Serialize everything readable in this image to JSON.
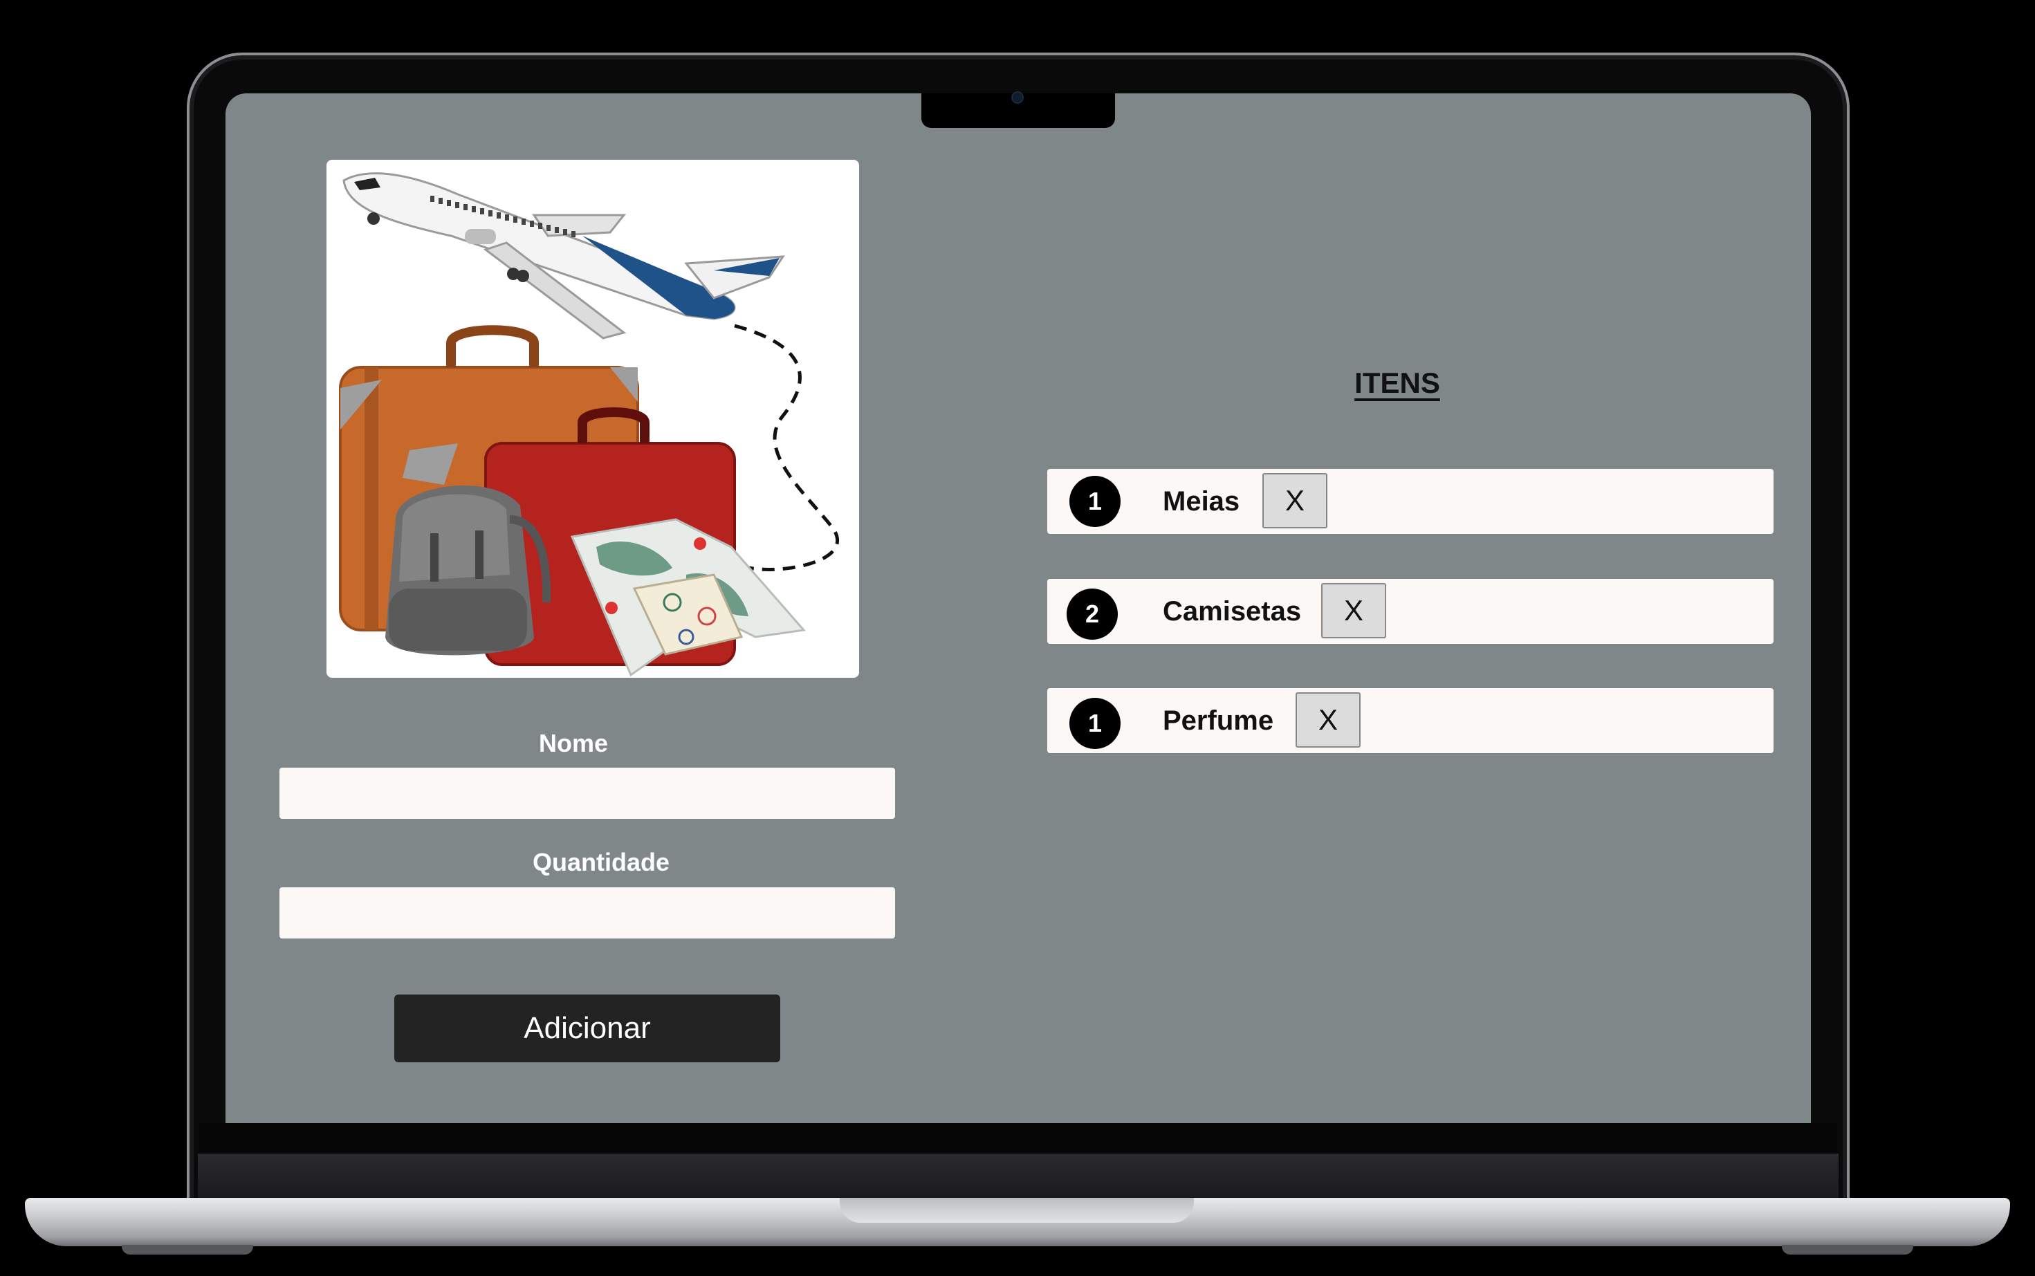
{
  "form": {
    "name_label": "Nome",
    "quantity_label": "Quantidade",
    "name_value": "",
    "quantity_value": "",
    "submit_label": "Adicionar"
  },
  "list": {
    "title": "ITENS",
    "items": [
      {
        "quantity": "1",
        "name": "Meias",
        "remove_label": "X"
      },
      {
        "quantity": "2",
        "name": "Camisetas",
        "remove_label": "X"
      },
      {
        "quantity": "1",
        "name": "Perfume",
        "remove_label": "X"
      }
    ]
  },
  "illustration": {
    "subject": "travel-illustration",
    "elements": [
      "airplane",
      "orange-suitcase",
      "red-suitcase",
      "gray-backpack",
      "world-map",
      "passport"
    ]
  },
  "colors": {
    "screen_background": "#808789",
    "button_dark": "#232323",
    "input_background": "#fbf8f6",
    "airplane_accent": "#1e5288"
  }
}
